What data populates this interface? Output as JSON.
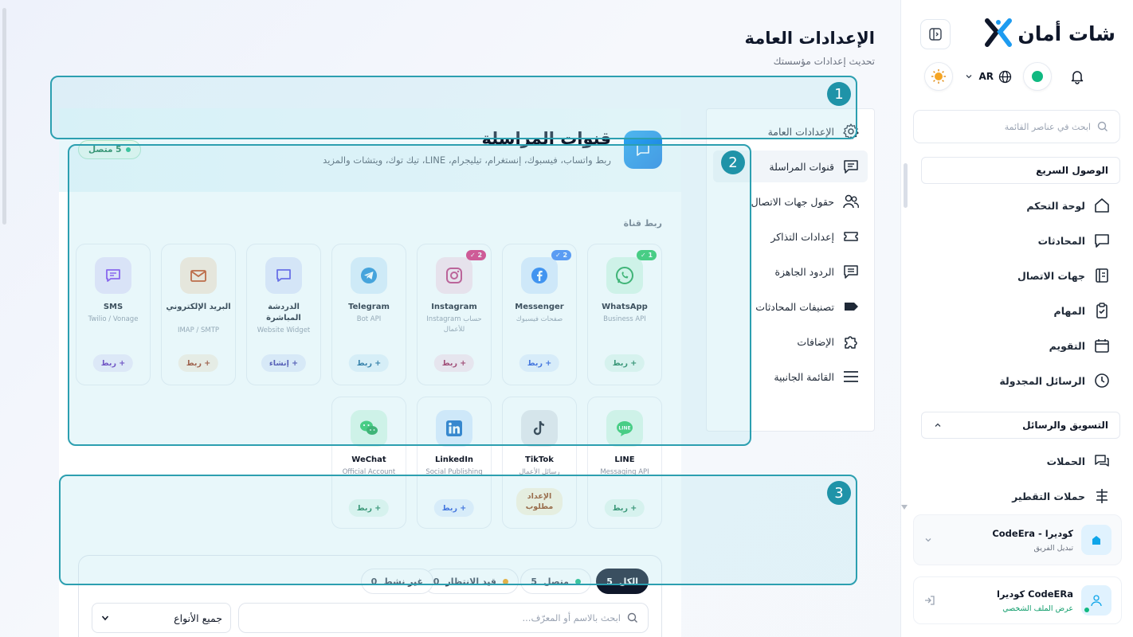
{
  "sidebar": {
    "brand": "شات أمان",
    "language": "AR",
    "search_placeholder": "ابحث في عناصر القائمة",
    "quick_access_label": "الوصول السريع",
    "items": [
      {
        "label": "لوحة التحكم",
        "icon": "home-icon"
      },
      {
        "label": "المحادثات",
        "icon": "chat-icon"
      },
      {
        "label": "جهات الاتصال",
        "icon": "contacts-book-icon"
      },
      {
        "label": "المهام",
        "icon": "clipboard-check-icon"
      },
      {
        "label": "التقويم",
        "icon": "calendar-icon"
      },
      {
        "label": "الرسائل المجدولة",
        "icon": "clock-icon"
      }
    ],
    "marketing_label": "التسويق والرسائل",
    "marketing_items": [
      {
        "label": "الحملات",
        "icon": "campaign-chat-icon"
      },
      {
        "label": "حملات التقطير",
        "icon": "drip-icon"
      }
    ],
    "team": {
      "name": "كوديرا - CodeEra",
      "action": "تبديل الفريق"
    },
    "profile": {
      "name": "CodeERa كوديرا",
      "action": "عرض الملف الشخصي"
    }
  },
  "header": {
    "title": "الإعدادات العامة",
    "subtitle": "تحديث إعدادات مؤسستك"
  },
  "settings_menu": [
    {
      "label": "الإعدادات العامة",
      "icon": "gear-icon",
      "active": false
    },
    {
      "label": "قنوات المراسلة",
      "icon": "message-square-icon",
      "active": true
    },
    {
      "label": "حقول جهات الاتصال",
      "icon": "users-icon",
      "active": false
    },
    {
      "label": "إعدادات التذاكر",
      "icon": "ticket-icon",
      "active": false
    },
    {
      "label": "الردود الجاهزة",
      "icon": "canned-reply-icon",
      "active": false
    },
    {
      "label": "تصنيفات المحادثات",
      "icon": "tag-icon",
      "active": false
    },
    {
      "label": "الإضافات",
      "icon": "puzzle-icon",
      "active": false
    },
    {
      "label": "القائمة الجانبية",
      "icon": "menu-icon",
      "active": false
    }
  ],
  "channels": {
    "title": "قنوات المراسلة",
    "description": "ربط واتساب، فيسبوك، إنستغرام، تيليجرام، LINE، تيك توك، ويتشات والمزيد",
    "connected_pill": "5 متصل",
    "connect_label": "ربط قناة",
    "cards": [
      {
        "name": "WhatsApp",
        "sub": "Business API",
        "button": "+ ربط",
        "badge": "1 ✓"
      },
      {
        "name": "Messenger",
        "sub": "صفحات فيسبوك",
        "button": "+ ربط",
        "badge": "2 ✓"
      },
      {
        "name": "Instagram",
        "sub": "حساب Instagram للأعمال",
        "button": "+ ربط",
        "badge": "2 ✓"
      },
      {
        "name": "Telegram",
        "sub": "Bot API",
        "button": "+ ربط",
        "badge": ""
      },
      {
        "name": "الدردشة المباشرة",
        "sub": "Website Widget",
        "button": "+ إنشاء",
        "badge": ""
      },
      {
        "name": "البريد الإلكتروني",
        "sub": "IMAP / SMTP",
        "button": "+ ربط",
        "badge": ""
      },
      {
        "name": "SMS",
        "sub": "Twilio / Vonage",
        "button": "+ ربط",
        "badge": ""
      },
      {
        "name": "LINE",
        "sub": "Messaging API",
        "button": "+ ربط",
        "badge": ""
      },
      {
        "name": "TikTok",
        "sub": "رسائل الأعمال",
        "button": "الإعداد مطلوب",
        "badge": ""
      },
      {
        "name": "LinkedIn",
        "sub": "Social Publishing",
        "button": "+ ربط",
        "badge": ""
      },
      {
        "name": "WeChat",
        "sub": "Official Account",
        "button": "+ ربط",
        "badge": ""
      }
    ]
  },
  "filters": {
    "tabs": [
      {
        "label": "الكل",
        "count": "5"
      },
      {
        "label": "متصل",
        "count": "5"
      },
      {
        "label": "قيد الانتظار",
        "count": "0"
      },
      {
        "label": "غير نشط",
        "count": "0"
      }
    ],
    "search_placeholder": "ابحث بالاسم أو المعرّف...",
    "type_select": "جميع الأنواع"
  },
  "overlays": [
    "1",
    "2",
    "3"
  ],
  "colors": {
    "accent": "#1d7fe0",
    "connected": "#10b981",
    "overlay": "#2c9fb0"
  }
}
